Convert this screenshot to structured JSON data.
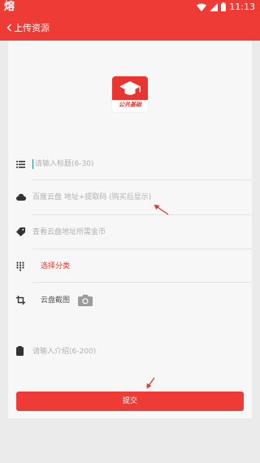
{
  "status_bar": {
    "left_glyph": "熔",
    "time": "11:13"
  },
  "app_bar": {
    "back_label": "上传资源"
  },
  "logo": {
    "text": "公共基础"
  },
  "form": {
    "title_placeholder": "请输入标题(6-30)",
    "cloud_placeholder": "百度云盘 地址+提取码 (购买后显示)",
    "price_placeholder": "查看云盘地址所需金币",
    "category_label": "选择分类",
    "screenshot_label": "云盘截图",
    "intro_placeholder": "请输入介绍(6-200)",
    "submit_label": "提交"
  },
  "colors": {
    "accent": "#ef3b35",
    "caret": "#1d8f8b"
  }
}
